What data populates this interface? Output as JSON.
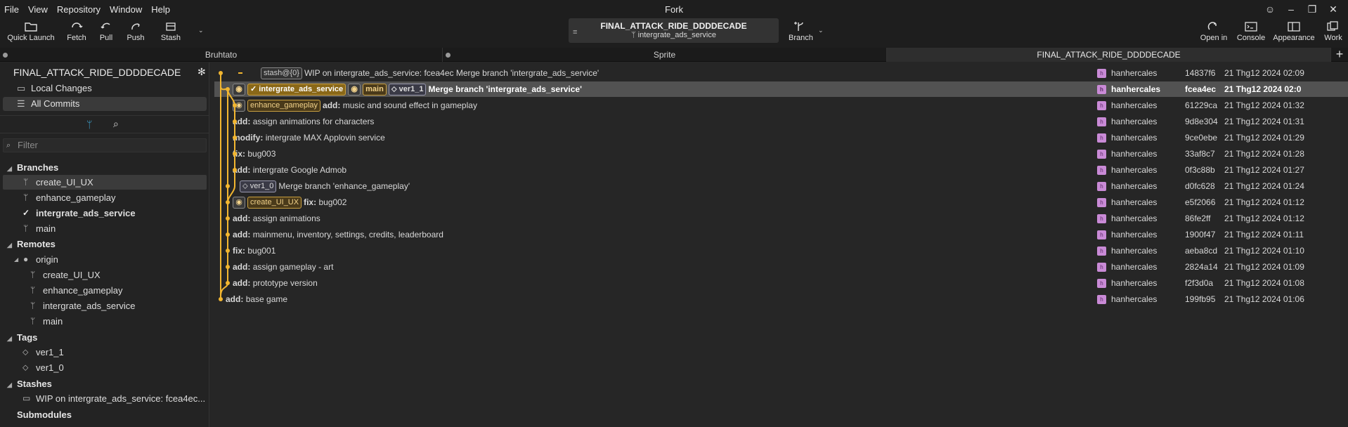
{
  "window": {
    "title": "Fork",
    "controls": [
      "☺",
      "–",
      "❐",
      "✕"
    ]
  },
  "menu": [
    "File",
    "View",
    "Repository",
    "Window",
    "Help"
  ],
  "toolbar": {
    "quick_launch": "Quick Launch",
    "fetch": "Fetch",
    "pull": "Pull",
    "push": "Push",
    "stash": "Stash",
    "repo_name": "FINAL_ATTACK_RIDE_DDDDECADE",
    "repo_branch": "intergrate_ads_service",
    "branch": "Branch",
    "open_in": "Open in",
    "console": "Console",
    "appearance": "Appearance",
    "work": "Work"
  },
  "tabs": [
    "Bruhtato",
    "Sprite",
    "FINAL_ATTACK_RIDE_DDDDECADE"
  ],
  "sidebar": {
    "repo_name": "FINAL_ATTACK_RIDE_DDDDECADE",
    "local_changes": "Local Changes",
    "all_commits": "All Commits",
    "filter_placeholder": "Filter",
    "branches_label": "Branches",
    "branches": [
      "create_UI_UX",
      "enhance_gameplay",
      "intergrate_ads_service",
      "main"
    ],
    "remotes_label": "Remotes",
    "origin": "origin",
    "remote_branches": [
      "create_UI_UX",
      "enhance_gameplay",
      "intergrate_ads_service",
      "main"
    ],
    "tags_label": "Tags",
    "tags": [
      "ver1_1",
      "ver1_0"
    ],
    "stashes_label": "Stashes",
    "stashes": [
      "WIP on intergrate_ads_service: fcea4ec..."
    ],
    "submodules_label": "Submodules"
  },
  "commits": [
    {
      "refs": {
        "stash": "stash@{0}"
      },
      "prefix": "",
      "message": "WIP on intergrate_ads_service: fcea4ec Merge branch 'intergrate_ads_service'",
      "author": "hanhercales",
      "sha": "14837f6",
      "date": "21 Thg12 2024 02:09"
    },
    {
      "refs": {
        "head": "intergrate_ads_service",
        "b2": "main",
        "tag": "ver1_1"
      },
      "prefix": "",
      "message": "Merge branch 'intergrate_ads_service'",
      "author": "hanhercales",
      "sha": "fcea4ec",
      "date": "21 Thg12 2024 02:0",
      "selected": true
    },
    {
      "refs": {
        "b1": "enhance_gameplay"
      },
      "prefix": "add:",
      "message": "music and sound effect in gameplay",
      "author": "hanhercales",
      "sha": "61229ca",
      "date": "21 Thg12 2024 01:32"
    },
    {
      "prefix": "add:",
      "message": "assign animations for characters",
      "author": "hanhercales",
      "sha": "9d8e304",
      "date": "21 Thg12 2024 01:31"
    },
    {
      "prefix": "modify:",
      "message": "intergrate MAX Applovin service",
      "author": "hanhercales",
      "sha": "9ce0ebe",
      "date": "21 Thg12 2024 01:29"
    },
    {
      "prefix": "fix:",
      "message": "bug003",
      "author": "hanhercales",
      "sha": "33af8c7",
      "date": "21 Thg12 2024 01:28"
    },
    {
      "prefix": "add:",
      "message": "intergrate Google Admob",
      "author": "hanhercales",
      "sha": "0f3c88b",
      "date": "21 Thg12 2024 01:27"
    },
    {
      "refs": {
        "tag": "ver1_0"
      },
      "prefix": "",
      "message": "Merge branch 'enhance_gameplay'",
      "author": "hanhercales",
      "sha": "d0fc628",
      "date": "21 Thg12 2024 01:24"
    },
    {
      "refs": {
        "b1": "create_UI_UX"
      },
      "prefix": "fix:",
      "message": "bug002",
      "author": "hanhercales",
      "sha": "e5f2066",
      "date": "21 Thg12 2024 01:12"
    },
    {
      "prefix": "add:",
      "message": "assign animations",
      "author": "hanhercales",
      "sha": "86fe2ff",
      "date": "21 Thg12 2024 01:12"
    },
    {
      "prefix": "add:",
      "message": "mainmenu, inventory, settings, credits, leaderboard",
      "author": "hanhercales",
      "sha": "1900f47",
      "date": "21 Thg12 2024 01:11"
    },
    {
      "prefix": "fix:",
      "message": "bug001",
      "author": "hanhercales",
      "sha": "aeba8cd",
      "date": "21 Thg12 2024 01:10"
    },
    {
      "prefix": "add:",
      "message": "assign gameplay - art",
      "author": "hanhercales",
      "sha": "2824a14",
      "date": "21 Thg12 2024 01:09"
    },
    {
      "prefix": "add:",
      "message": "prototype version",
      "author": "hanhercales",
      "sha": "f2f3d0a",
      "date": "21 Thg12 2024 01:08"
    },
    {
      "prefix": "add:",
      "message": "base game",
      "author": "hanhercales",
      "sha": "199fb95",
      "date": "21 Thg12 2024 01:06"
    }
  ],
  "colors": {
    "graph": "#f2b630",
    "accent": "#3fa7d6",
    "badge_border": "#caa040"
  }
}
